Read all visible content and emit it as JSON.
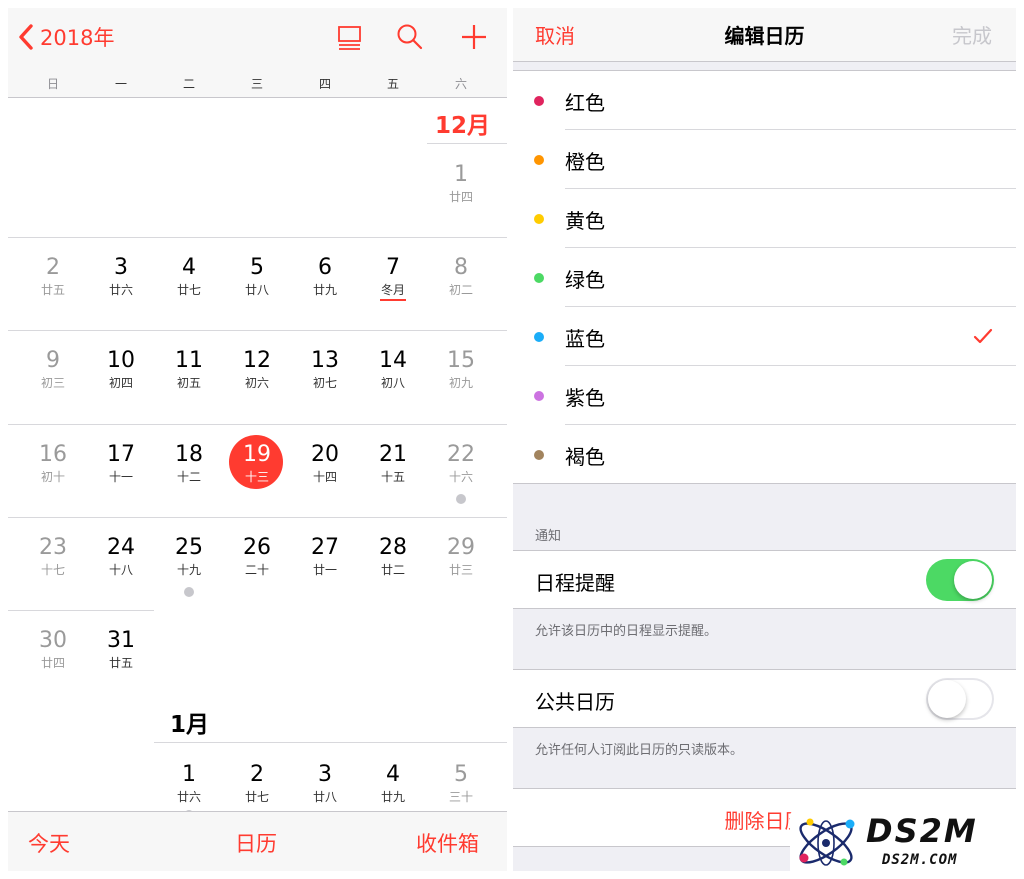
{
  "calendar": {
    "back_label": "2018年",
    "icons": {
      "list": "list-view-icon",
      "search": "search-icon",
      "add": "add-icon"
    },
    "weekdays": [
      "日",
      "一",
      "二",
      "三",
      "四",
      "五",
      "六"
    ],
    "months": {
      "dec": "12月",
      "jan": "1月"
    },
    "days": [
      {
        "num": "1",
        "lunar": "廿四"
      },
      {
        "num": "2",
        "lunar": "廿五"
      },
      {
        "num": "3",
        "lunar": "廿六"
      },
      {
        "num": "4",
        "lunar": "廿七"
      },
      {
        "num": "5",
        "lunar": "廿八"
      },
      {
        "num": "6",
        "lunar": "廿九"
      },
      {
        "num": "7",
        "lunar": "冬月"
      },
      {
        "num": "8",
        "lunar": "初二"
      },
      {
        "num": "9",
        "lunar": "初三"
      },
      {
        "num": "10",
        "lunar": "初四"
      },
      {
        "num": "11",
        "lunar": "初五"
      },
      {
        "num": "12",
        "lunar": "初六"
      },
      {
        "num": "13",
        "lunar": "初七"
      },
      {
        "num": "14",
        "lunar": "初八"
      },
      {
        "num": "15",
        "lunar": "初九"
      },
      {
        "num": "16",
        "lunar": "初十"
      },
      {
        "num": "17",
        "lunar": "十一"
      },
      {
        "num": "18",
        "lunar": "十二"
      },
      {
        "num": "19",
        "lunar": "十三"
      },
      {
        "num": "20",
        "lunar": "十四"
      },
      {
        "num": "21",
        "lunar": "十五"
      },
      {
        "num": "22",
        "lunar": "十六"
      },
      {
        "num": "23",
        "lunar": "十七"
      },
      {
        "num": "24",
        "lunar": "十八"
      },
      {
        "num": "25",
        "lunar": "十九"
      },
      {
        "num": "26",
        "lunar": "二十"
      },
      {
        "num": "27",
        "lunar": "廿一"
      },
      {
        "num": "28",
        "lunar": "廿二"
      },
      {
        "num": "29",
        "lunar": "廿三"
      },
      {
        "num": "30",
        "lunar": "廿四"
      },
      {
        "num": "31",
        "lunar": "廿五"
      }
    ],
    "jan_days": [
      {
        "num": "1",
        "lunar": "廿六"
      },
      {
        "num": "2",
        "lunar": "廿七"
      },
      {
        "num": "3",
        "lunar": "廿八"
      },
      {
        "num": "4",
        "lunar": "廿九"
      },
      {
        "num": "5",
        "lunar": "三十"
      }
    ],
    "tabs": {
      "today": "今天",
      "calendars": "日历",
      "inbox": "收件箱"
    }
  },
  "edit": {
    "cancel": "取消",
    "title": "编辑日历",
    "done": "完成",
    "colors": [
      {
        "label": "红色",
        "color": "#e0245e",
        "selected": false
      },
      {
        "label": "橙色",
        "color": "#ff9500",
        "selected": false
      },
      {
        "label": "黄色",
        "color": "#ffcc00",
        "selected": false
      },
      {
        "label": "绿色",
        "color": "#4cd964",
        "selected": false
      },
      {
        "label": "蓝色",
        "color": "#1badf8",
        "selected": true
      },
      {
        "label": "紫色",
        "color": "#cc73e1",
        "selected": false
      },
      {
        "label": "褐色",
        "color": "#a2845e",
        "selected": false
      }
    ],
    "notify_header": "通知",
    "event_alerts": {
      "label": "日程提醒",
      "on": true,
      "footer": "允许该日历中的日程显示提醒。"
    },
    "public_calendar": {
      "label": "公共日历",
      "on": false,
      "footer": "允许任何人订阅此日历的只读版本。"
    },
    "delete_label": "删除日历"
  },
  "watermark": {
    "brand": "DS2M",
    "url": "DS2M.COM"
  },
  "colors": {
    "accent": "#ff3b30",
    "switch_on": "#4cd964",
    "muted": "#9a9a9a",
    "dot_gray": "#c7c7cc"
  }
}
